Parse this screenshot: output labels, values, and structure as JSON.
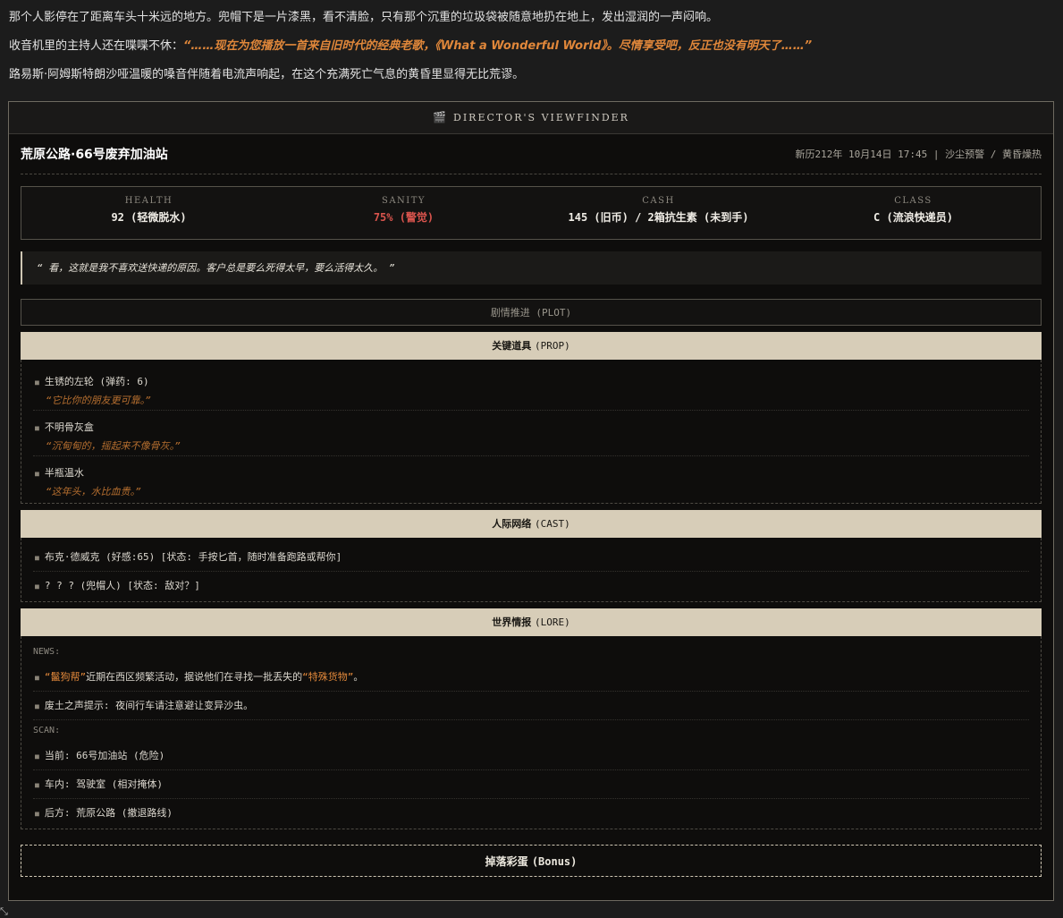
{
  "story": {
    "p1": "那个人影停在了距离车头十米远的地方。兜帽下是一片漆黑，看不清脸，只有那个沉重的垃圾袋被随意地扔在地上，发出湿润的一声闷响。",
    "p2_prefix": "收音机里的主持人还在喋喋不休：",
    "p2_quote": "“……现在为您播放一首来自旧时代的经典老歌，《What a Wonderful World》。尽情享受吧，反正也没有明天了……”",
    "p3": "路易斯·阿姆斯特朗沙哑温暖的嗓音伴随着电流声响起，在这个充满死亡气息的黄昏里显得无比荒谬。"
  },
  "viewfinder": {
    "icon": "clapperboard-icon",
    "title": "DIRECTOR'S VIEWFINDER",
    "location": "荒原公路·66号废弃加油站",
    "meta": "新历212年 10月14日 17:45 | 沙尘预警 / 黄昏燥热",
    "stats": [
      {
        "label": "HEALTH",
        "value": "92 (轻微脱水)",
        "warn": false
      },
      {
        "label": "SANITY",
        "value": "75% (警觉)",
        "warn": true
      },
      {
        "label": "CASH",
        "value": "145 (旧币) / 2箱抗生素 (未到手)",
        "warn": false
      },
      {
        "label": "CLASS",
        "value": "C (流浪快递员)",
        "warn": false
      }
    ],
    "monologue": "“ 看，这就是我不喜欢送快递的原因。客户总是要么死得太早，要么活得太久。 ”",
    "plot_label": "剧情推进 (PLOT)",
    "props": {
      "title": "关键道具",
      "title_en": "(PROP)",
      "items": [
        {
          "name": "生锈的左轮 (弹药: 6)",
          "desc": "“它比你的朋友更可靠。”"
        },
        {
          "name": "不明骨灰盒",
          "desc": "“沉甸甸的，摇起来不像骨灰。”"
        },
        {
          "name": "半瓶温水",
          "desc": "“这年头，水比血贵。”"
        }
      ]
    },
    "cast": {
      "title": "人际网络",
      "title_en": "(CAST)",
      "items": [
        "布克·德威克 (好感:65) [状态: 手按匕首，随时准备跑路或帮你]",
        "? ? ? (兜帽人) [状态: 敌对？]"
      ]
    },
    "lore": {
      "title": "世界情报",
      "title_en": "(LORE)",
      "news_label": "NEWS:",
      "news": [
        {
          "q1": "“鬣狗帮”",
          "mid": "近期在西区频繁活动，据说他们在寻找一批丢失的",
          "q2": "“特殊货物”",
          "end": "。"
        },
        {
          "text": "废土之声提示: 夜间行车请注意避让变异沙虫。"
        }
      ],
      "scan_label": "SCAN:",
      "scan": [
        "当前: 66号加油站 (危险)",
        "车内: 驾驶室 (相对掩体)",
        "后方: 荒原公路 (撤退路线)"
      ]
    },
    "bonus": {
      "label": "掉落彩蛋",
      "label_en": "(Bonus)"
    }
  },
  "colors": {
    "accent": "#e0873a",
    "warn": "#d9544d",
    "section_bg": "#d7cdb8"
  }
}
